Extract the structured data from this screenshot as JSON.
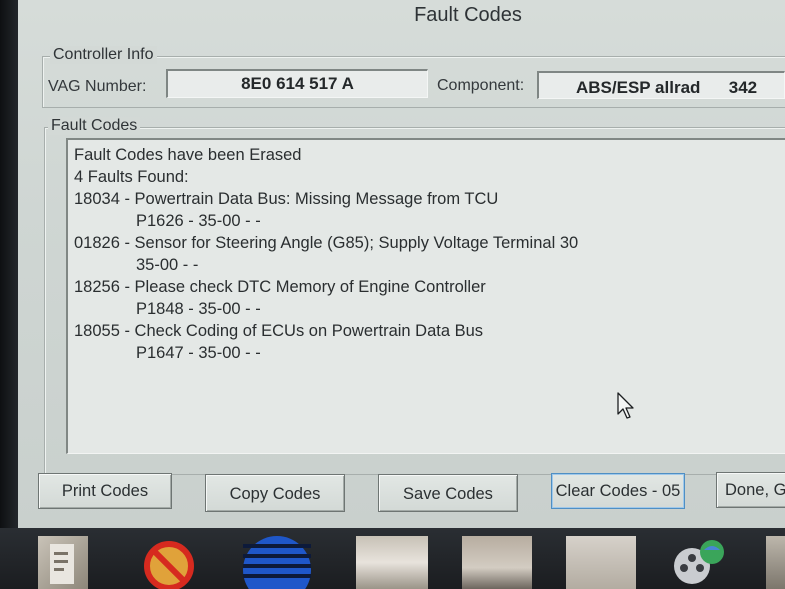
{
  "window": {
    "title": "Fault Codes"
  },
  "controller_info": {
    "group_label": "Controller Info",
    "vag_label": "VAG Number:",
    "vag_value": "8E0 614 517 A",
    "component_label": "Component:",
    "component_value": "ABS/ESP allrad      342"
  },
  "fault_codes": {
    "group_label": "Fault Codes",
    "lines": [
      "Fault Codes have been Erased",
      "4 Faults Found:",
      "18034 - Powertrain Data Bus: Missing Message from TCU",
      "P1626 - 35-00 -  -",
      "01826 - Sensor for Steering Angle (G85); Supply Voltage Terminal 30",
      "35-00 -  -",
      "18256 - Please check DTC Memory of Engine Controller",
      "P1848 - 35-00 -  -",
      "18055 - Check Coding of ECUs on Powertrain Data Bus",
      "P1647 - 35-00 -  -"
    ]
  },
  "buttons": {
    "print": "Print Codes",
    "copy": "Copy Codes",
    "save": "Save Codes",
    "clear": "Clear Codes - 05",
    "done": "Done, G"
  },
  "icons": {
    "cursor": "mouse-pointer-icon",
    "taskbar": [
      "document-icon",
      "no-sign-icon",
      "globe-icon",
      "photo-icon",
      "photo-icon",
      "photo-icon",
      "film-reel-icon"
    ]
  },
  "colors": {
    "window_bg": "#d3d9d6",
    "field_bg": "#e4e8e6",
    "clear_button_focus": "#4f8fc4"
  }
}
